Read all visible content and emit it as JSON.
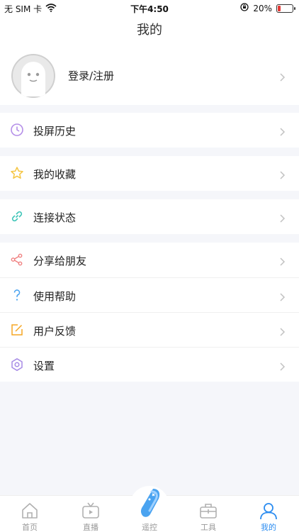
{
  "status_bar": {
    "carrier": "无 SIM 卡",
    "time": "下午4:50",
    "battery": "20%",
    "battery_level": 0.2
  },
  "header": {
    "title": "我的"
  },
  "profile": {
    "label": "登录/注册"
  },
  "menu": {
    "history": "投屏历史",
    "favorites": "我的收藏",
    "connection": "连接状态",
    "share": "分享给朋友",
    "help": "使用帮助",
    "feedback": "用户反馈",
    "settings": "设置"
  },
  "tabbar": {
    "home": "首页",
    "live": "直播",
    "remote": "遥控",
    "tools": "工具",
    "mine": "我的"
  },
  "colors": {
    "accent": "#2b8cf0",
    "battery_low": "#e53935",
    "history_icon": "#b48ee8",
    "favorites_icon": "#f5c542",
    "connection_icon": "#3fc5b8",
    "share_icon": "#f08080",
    "help_icon": "#4aa3f0",
    "feedback_icon": "#f5a623",
    "settings_icon": "#a78be6"
  }
}
